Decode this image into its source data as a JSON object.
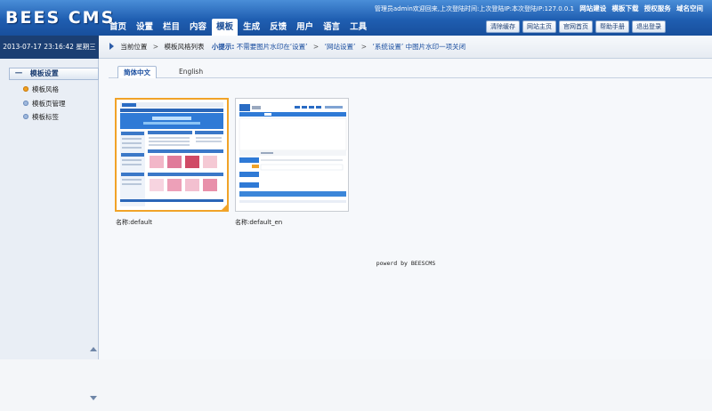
{
  "app": {
    "logo": "BEES CMS"
  },
  "top_info": {
    "welcome": "管理员admin欢迎回来,上次登陆时间:上次登陆IP:本次登陆IP:127.0.0.1",
    "links": [
      "网站建设",
      "模板下载",
      "授权服务",
      "域名空间"
    ]
  },
  "nav": {
    "items": [
      "首页",
      "设置",
      "栏目",
      "内容",
      "模板",
      "生成",
      "反馈",
      "用户",
      "语言",
      "工具"
    ],
    "active_index": 4
  },
  "top_buttons": [
    "清除缓存",
    "网站主页",
    "官网首页",
    "帮助手册",
    "退出登录"
  ],
  "datetime": "2013-07-17 23:16:42 星期三",
  "breadcrumb": {
    "current": "当前位置",
    "page": "模板风格列表",
    "tip_label": "小提示:",
    "tip_text": "不需要图片水印在‘设置’",
    "tip_step2": "‘网站设置’",
    "tip_step3": "‘系统设置’ 中图片水印一项关闭",
    "separator": ">"
  },
  "sidebar": {
    "group_title": "模板设置",
    "collapse_symbol": "一",
    "items": [
      {
        "label": "模板风格",
        "active": true
      },
      {
        "label": "模板页管理",
        "active": false
      },
      {
        "label": "模板标签",
        "active": false
      }
    ]
  },
  "tabs": [
    {
      "label": "简体中文",
      "active": true
    },
    {
      "label": "English",
      "active": false
    }
  ],
  "templates": [
    {
      "name_label": "名称:",
      "name": "default",
      "selected": true
    },
    {
      "name_label": "名称:",
      "name": "default_en",
      "selected": false
    }
  ],
  "footer": "powerd by BEESCMS",
  "colors": {
    "header_blue": "#1f5eb1",
    "date_bg": "#1b3f73",
    "accent_orange": "#f1a328",
    "link_blue": "#1b4fa0"
  }
}
